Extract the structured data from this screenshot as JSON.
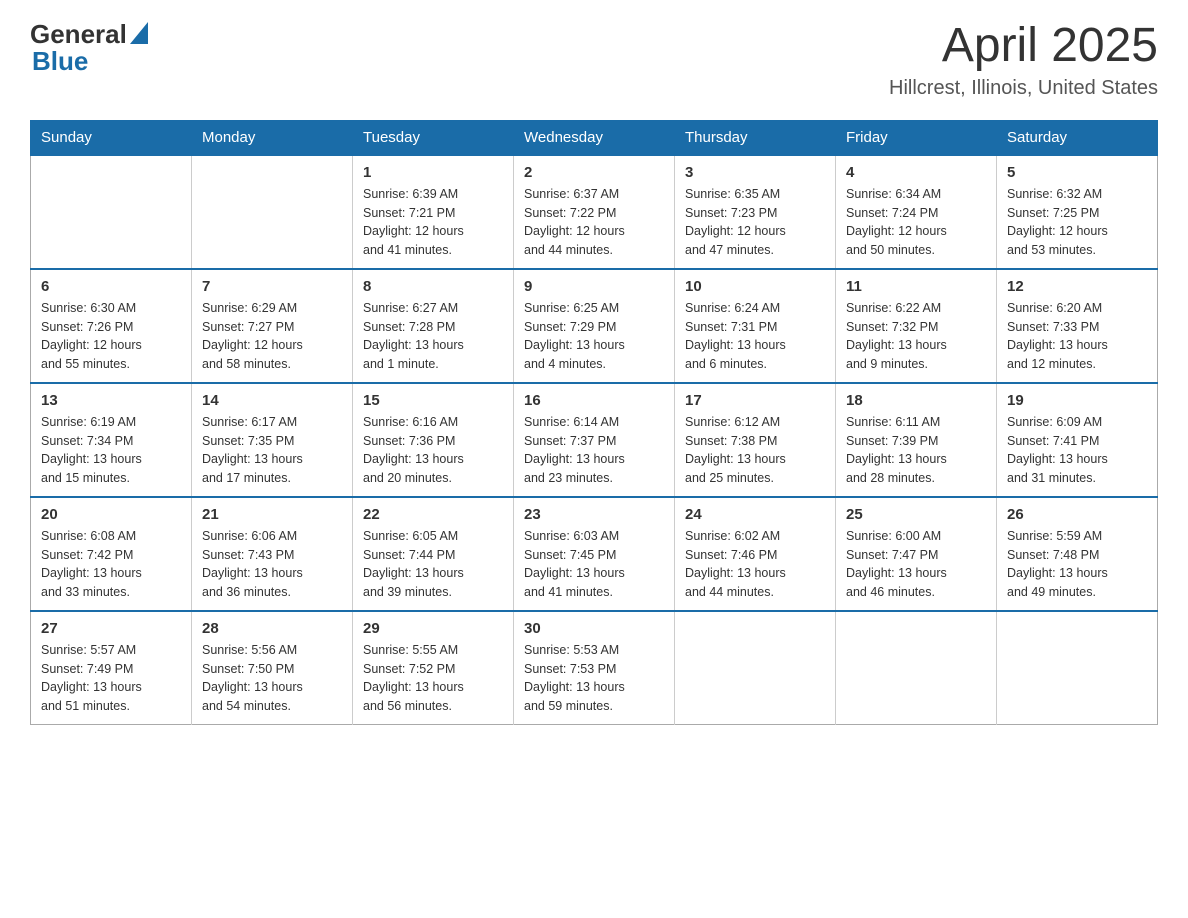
{
  "logo": {
    "general": "General",
    "blue": "Blue"
  },
  "title": "April 2025",
  "subtitle": "Hillcrest, Illinois, United States",
  "days_of_week": [
    "Sunday",
    "Monday",
    "Tuesday",
    "Wednesday",
    "Thursday",
    "Friday",
    "Saturday"
  ],
  "weeks": [
    [
      {
        "day": "",
        "info": ""
      },
      {
        "day": "",
        "info": ""
      },
      {
        "day": "1",
        "info": "Sunrise: 6:39 AM\nSunset: 7:21 PM\nDaylight: 12 hours\nand 41 minutes."
      },
      {
        "day": "2",
        "info": "Sunrise: 6:37 AM\nSunset: 7:22 PM\nDaylight: 12 hours\nand 44 minutes."
      },
      {
        "day": "3",
        "info": "Sunrise: 6:35 AM\nSunset: 7:23 PM\nDaylight: 12 hours\nand 47 minutes."
      },
      {
        "day": "4",
        "info": "Sunrise: 6:34 AM\nSunset: 7:24 PM\nDaylight: 12 hours\nand 50 minutes."
      },
      {
        "day": "5",
        "info": "Sunrise: 6:32 AM\nSunset: 7:25 PM\nDaylight: 12 hours\nand 53 minutes."
      }
    ],
    [
      {
        "day": "6",
        "info": "Sunrise: 6:30 AM\nSunset: 7:26 PM\nDaylight: 12 hours\nand 55 minutes."
      },
      {
        "day": "7",
        "info": "Sunrise: 6:29 AM\nSunset: 7:27 PM\nDaylight: 12 hours\nand 58 minutes."
      },
      {
        "day": "8",
        "info": "Sunrise: 6:27 AM\nSunset: 7:28 PM\nDaylight: 13 hours\nand 1 minute."
      },
      {
        "day": "9",
        "info": "Sunrise: 6:25 AM\nSunset: 7:29 PM\nDaylight: 13 hours\nand 4 minutes."
      },
      {
        "day": "10",
        "info": "Sunrise: 6:24 AM\nSunset: 7:31 PM\nDaylight: 13 hours\nand 6 minutes."
      },
      {
        "day": "11",
        "info": "Sunrise: 6:22 AM\nSunset: 7:32 PM\nDaylight: 13 hours\nand 9 minutes."
      },
      {
        "day": "12",
        "info": "Sunrise: 6:20 AM\nSunset: 7:33 PM\nDaylight: 13 hours\nand 12 minutes."
      }
    ],
    [
      {
        "day": "13",
        "info": "Sunrise: 6:19 AM\nSunset: 7:34 PM\nDaylight: 13 hours\nand 15 minutes."
      },
      {
        "day": "14",
        "info": "Sunrise: 6:17 AM\nSunset: 7:35 PM\nDaylight: 13 hours\nand 17 minutes."
      },
      {
        "day": "15",
        "info": "Sunrise: 6:16 AM\nSunset: 7:36 PM\nDaylight: 13 hours\nand 20 minutes."
      },
      {
        "day": "16",
        "info": "Sunrise: 6:14 AM\nSunset: 7:37 PM\nDaylight: 13 hours\nand 23 minutes."
      },
      {
        "day": "17",
        "info": "Sunrise: 6:12 AM\nSunset: 7:38 PM\nDaylight: 13 hours\nand 25 minutes."
      },
      {
        "day": "18",
        "info": "Sunrise: 6:11 AM\nSunset: 7:39 PM\nDaylight: 13 hours\nand 28 minutes."
      },
      {
        "day": "19",
        "info": "Sunrise: 6:09 AM\nSunset: 7:41 PM\nDaylight: 13 hours\nand 31 minutes."
      }
    ],
    [
      {
        "day": "20",
        "info": "Sunrise: 6:08 AM\nSunset: 7:42 PM\nDaylight: 13 hours\nand 33 minutes."
      },
      {
        "day": "21",
        "info": "Sunrise: 6:06 AM\nSunset: 7:43 PM\nDaylight: 13 hours\nand 36 minutes."
      },
      {
        "day": "22",
        "info": "Sunrise: 6:05 AM\nSunset: 7:44 PM\nDaylight: 13 hours\nand 39 minutes."
      },
      {
        "day": "23",
        "info": "Sunrise: 6:03 AM\nSunset: 7:45 PM\nDaylight: 13 hours\nand 41 minutes."
      },
      {
        "day": "24",
        "info": "Sunrise: 6:02 AM\nSunset: 7:46 PM\nDaylight: 13 hours\nand 44 minutes."
      },
      {
        "day": "25",
        "info": "Sunrise: 6:00 AM\nSunset: 7:47 PM\nDaylight: 13 hours\nand 46 minutes."
      },
      {
        "day": "26",
        "info": "Sunrise: 5:59 AM\nSunset: 7:48 PM\nDaylight: 13 hours\nand 49 minutes."
      }
    ],
    [
      {
        "day": "27",
        "info": "Sunrise: 5:57 AM\nSunset: 7:49 PM\nDaylight: 13 hours\nand 51 minutes."
      },
      {
        "day": "28",
        "info": "Sunrise: 5:56 AM\nSunset: 7:50 PM\nDaylight: 13 hours\nand 54 minutes."
      },
      {
        "day": "29",
        "info": "Sunrise: 5:55 AM\nSunset: 7:52 PM\nDaylight: 13 hours\nand 56 minutes."
      },
      {
        "day": "30",
        "info": "Sunrise: 5:53 AM\nSunset: 7:53 PM\nDaylight: 13 hours\nand 59 minutes."
      },
      {
        "day": "",
        "info": ""
      },
      {
        "day": "",
        "info": ""
      },
      {
        "day": "",
        "info": ""
      }
    ]
  ]
}
